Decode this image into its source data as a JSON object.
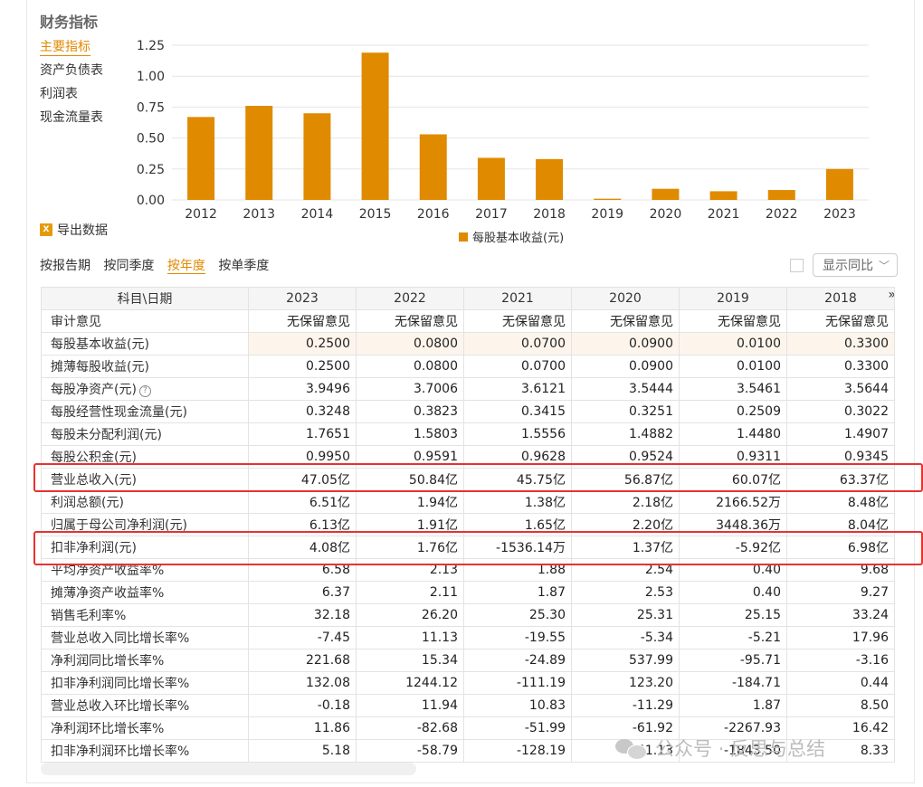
{
  "panel": {
    "title": "财务指标",
    "nav": [
      "主要指标",
      "资产负债表",
      "利润表",
      "现金流量表"
    ],
    "export_label": "导出数据",
    "export_icon": "excel-icon"
  },
  "chart_data": {
    "type": "bar",
    "categories": [
      "2012",
      "2013",
      "2014",
      "2015",
      "2016",
      "2017",
      "2018",
      "2019",
      "2020",
      "2021",
      "2022",
      "2023"
    ],
    "values": [
      0.67,
      0.76,
      0.7,
      1.19,
      0.53,
      0.34,
      0.33,
      0.01,
      0.09,
      0.07,
      0.08,
      0.25
    ],
    "series_name": "每股基本收益(元)",
    "ylim": [
      0,
      1.25
    ],
    "yticks": [
      "0.00",
      "0.25",
      "0.50",
      "0.75",
      "1.00",
      "1.25"
    ],
    "bar_color": "#e08a00",
    "grid": true,
    "legend": "bottom"
  },
  "period_tabs": [
    "按报告期",
    "按同季度",
    "按年度",
    "按单季度"
  ],
  "active_tab": "按年度",
  "yoy": {
    "label": "显示同比"
  },
  "table": {
    "header": "科目\\日期",
    "columns": [
      "2023",
      "2022",
      "2021",
      "2020",
      "2019",
      "2018"
    ],
    "more_icon": "»",
    "rows": [
      {
        "name": "审计意见",
        "values": [
          "无保留意见",
          "无保留意见",
          "无保留意见",
          "无保留意见",
          "无保留意见",
          "无保留意见"
        ]
      },
      {
        "name": "每股基本收益(元)",
        "values": [
          "0.2500",
          "0.0800",
          "0.0700",
          "0.0900",
          "0.0100",
          "0.3300"
        ]
      },
      {
        "name": "摊薄每股收益(元)",
        "values": [
          "0.2500",
          "0.0800",
          "0.0700",
          "0.0900",
          "0.0100",
          "0.3300"
        ]
      },
      {
        "name": "每股净资产(元)",
        "values": [
          "3.9496",
          "3.7006",
          "3.6121",
          "3.5444",
          "3.5461",
          "3.5644"
        ]
      },
      {
        "name": "每股经营性现金流量(元)",
        "values": [
          "0.3248",
          "0.3823",
          "0.3415",
          "0.3251",
          "0.2509",
          "0.3022"
        ]
      },
      {
        "name": "每股未分配利润(元)",
        "values": [
          "1.7651",
          "1.5803",
          "1.5556",
          "1.4882",
          "1.4480",
          "1.4907"
        ]
      },
      {
        "name": "每股公积金(元)",
        "values": [
          "0.9950",
          "0.9591",
          "0.9628",
          "0.9524",
          "0.9311",
          "0.9345"
        ]
      },
      {
        "name": "营业总收入(元)",
        "values": [
          "47.05亿",
          "50.84亿",
          "45.75亿",
          "56.87亿",
          "60.07亿",
          "63.37亿"
        ]
      },
      {
        "name": "利润总额(元)",
        "values": [
          "6.51亿",
          "1.94亿",
          "1.38亿",
          "2.18亿",
          "2166.52万",
          "8.48亿"
        ]
      },
      {
        "name": "归属于母公司净利润(元)",
        "values": [
          "6.13亿",
          "1.91亿",
          "1.65亿",
          "2.20亿",
          "3448.36万",
          "8.04亿"
        ]
      },
      {
        "name": "扣非净利润(元)",
        "values": [
          "4.08亿",
          "1.76亿",
          "-1536.14万",
          "1.37亿",
          "-5.92亿",
          "6.98亿"
        ]
      },
      {
        "name": "平均净资产收益率%",
        "values": [
          "6.58",
          "2.13",
          "1.88",
          "2.54",
          "0.40",
          "9.68"
        ]
      },
      {
        "name": "摊薄净资产收益率%",
        "values": [
          "6.37",
          "2.11",
          "1.87",
          "2.53",
          "0.40",
          "9.27"
        ]
      },
      {
        "name": "销售毛利率%",
        "values": [
          "32.18",
          "26.20",
          "25.30",
          "25.31",
          "25.15",
          "33.24"
        ]
      },
      {
        "name": "营业总收入同比增长率%",
        "values": [
          "-7.45",
          "11.13",
          "-19.55",
          "-5.34",
          "-5.21",
          "17.96"
        ]
      },
      {
        "name": "净利润同比增长率%",
        "values": [
          "221.68",
          "15.34",
          "-24.89",
          "537.99",
          "-95.71",
          "-3.16"
        ]
      },
      {
        "name": "扣非净利润同比增长率%",
        "values": [
          "132.08",
          "1244.12",
          "-111.19",
          "123.20",
          "-184.71",
          "0.44"
        ]
      },
      {
        "name": "营业总收入环比增长率%",
        "values": [
          "-0.18",
          "11.94",
          "10.83",
          "-11.29",
          "1.87",
          "8.50"
        ]
      },
      {
        "name": "净利润环比增长率%",
        "values": [
          "11.86",
          "-82.68",
          "-51.99",
          "-61.92",
          "-2267.93",
          "16.42"
        ]
      },
      {
        "name": "扣非净利润环比增长率%",
        "values": [
          "5.18",
          "-58.79",
          "-128.19",
          "-451.13",
          "-1843.50",
          "8.33"
        ]
      }
    ]
  },
  "watermark": "公众号 · 反思与总结",
  "highlight_color": "#e8322f"
}
